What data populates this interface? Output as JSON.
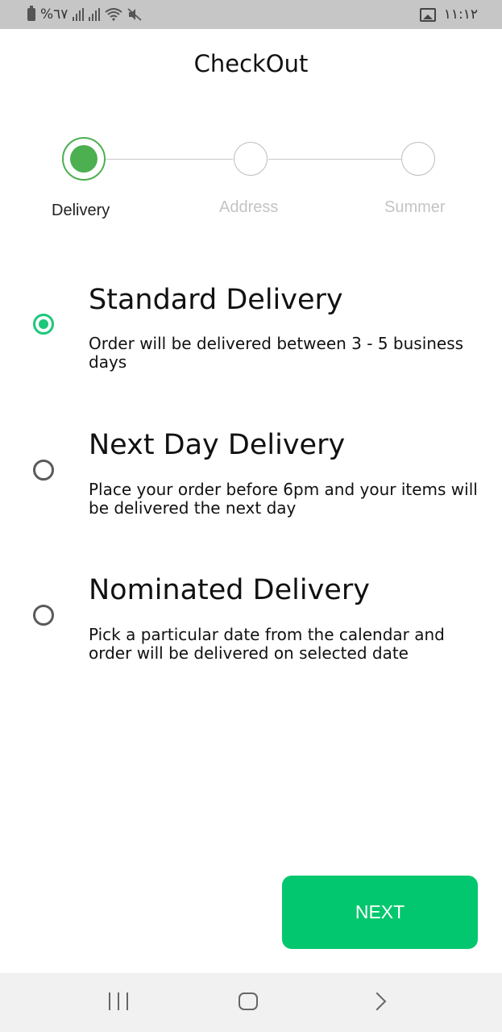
{
  "status_bar": {
    "battery_text": "%٦٧",
    "time": "١١:١٢",
    "icons": [
      "battery-icon",
      "signal-icon",
      "signal-icon",
      "wifi-icon",
      "mute-icon",
      "gallery-icon"
    ]
  },
  "header": {
    "title": "CheckOut"
  },
  "stepper": {
    "steps": [
      {
        "label": "Delivery",
        "state": "active"
      },
      {
        "label": "Address",
        "state": "inactive"
      },
      {
        "label": "Summer",
        "state": "inactive"
      }
    ],
    "active_color": "#4caf50"
  },
  "delivery_options": [
    {
      "title": "Standard Delivery",
      "description": "Order will be delivered between 3 - 5 business days",
      "selected": true
    },
    {
      "title": "Next Day Delivery",
      "description": "Place your order before 6pm and your items will be delivered the next day",
      "selected": false
    },
    {
      "title": "Nominated Delivery",
      "description": "Pick a particular date from the calendar and order will be delivered on selected date",
      "selected": false
    }
  ],
  "next_button": {
    "label": "NEXT",
    "color": "#03c76e"
  },
  "nav_bar": {
    "icons": [
      "recents-icon",
      "home-icon",
      "back-icon"
    ]
  }
}
